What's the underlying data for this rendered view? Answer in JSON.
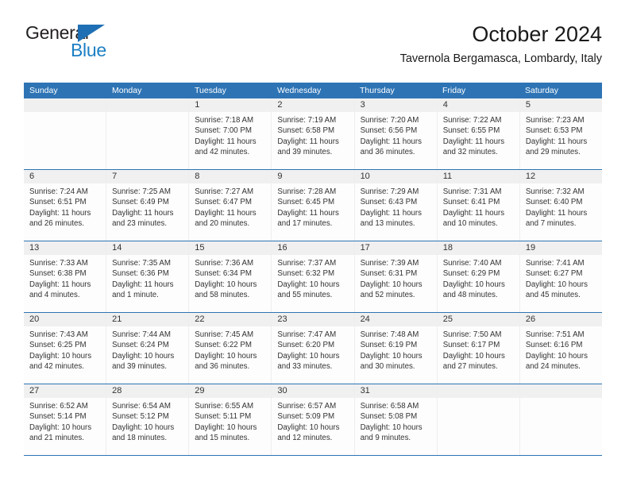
{
  "brand": {
    "name_top": "General",
    "name_bottom": "Blue",
    "colors": {
      "dark": "#231f20",
      "blue": "#1c7fc4",
      "triangle": "#1f6fb4"
    }
  },
  "header": {
    "title": "October 2024",
    "subtitle": "Tavernola Bergamasca, Lombardy, Italy"
  },
  "theme": {
    "header_blue": "#2e74b5",
    "date_band": "#f0f0f0",
    "cell_bg": "#fdfdfd",
    "column_line": "#eeeeee"
  },
  "weekdays": [
    "Sunday",
    "Monday",
    "Tuesday",
    "Wednesday",
    "Thursday",
    "Friday",
    "Saturday"
  ],
  "weeks": [
    [
      {
        "day": "",
        "sunrise": "",
        "sunset": "",
        "daylight": ""
      },
      {
        "day": "",
        "sunrise": "",
        "sunset": "",
        "daylight": ""
      },
      {
        "day": "1",
        "sunrise": "Sunrise: 7:18 AM",
        "sunset": "Sunset: 7:00 PM",
        "daylight": "Daylight: 11 hours and 42 minutes."
      },
      {
        "day": "2",
        "sunrise": "Sunrise: 7:19 AM",
        "sunset": "Sunset: 6:58 PM",
        "daylight": "Daylight: 11 hours and 39 minutes."
      },
      {
        "day": "3",
        "sunrise": "Sunrise: 7:20 AM",
        "sunset": "Sunset: 6:56 PM",
        "daylight": "Daylight: 11 hours and 36 minutes."
      },
      {
        "day": "4",
        "sunrise": "Sunrise: 7:22 AM",
        "sunset": "Sunset: 6:55 PM",
        "daylight": "Daylight: 11 hours and 32 minutes."
      },
      {
        "day": "5",
        "sunrise": "Sunrise: 7:23 AM",
        "sunset": "Sunset: 6:53 PM",
        "daylight": "Daylight: 11 hours and 29 minutes."
      }
    ],
    [
      {
        "day": "6",
        "sunrise": "Sunrise: 7:24 AM",
        "sunset": "Sunset: 6:51 PM",
        "daylight": "Daylight: 11 hours and 26 minutes."
      },
      {
        "day": "7",
        "sunrise": "Sunrise: 7:25 AM",
        "sunset": "Sunset: 6:49 PM",
        "daylight": "Daylight: 11 hours and 23 minutes."
      },
      {
        "day": "8",
        "sunrise": "Sunrise: 7:27 AM",
        "sunset": "Sunset: 6:47 PM",
        "daylight": "Daylight: 11 hours and 20 minutes."
      },
      {
        "day": "9",
        "sunrise": "Sunrise: 7:28 AM",
        "sunset": "Sunset: 6:45 PM",
        "daylight": "Daylight: 11 hours and 17 minutes."
      },
      {
        "day": "10",
        "sunrise": "Sunrise: 7:29 AM",
        "sunset": "Sunset: 6:43 PM",
        "daylight": "Daylight: 11 hours and 13 minutes."
      },
      {
        "day": "11",
        "sunrise": "Sunrise: 7:31 AM",
        "sunset": "Sunset: 6:41 PM",
        "daylight": "Daylight: 11 hours and 10 minutes."
      },
      {
        "day": "12",
        "sunrise": "Sunrise: 7:32 AM",
        "sunset": "Sunset: 6:40 PM",
        "daylight": "Daylight: 11 hours and 7 minutes."
      }
    ],
    [
      {
        "day": "13",
        "sunrise": "Sunrise: 7:33 AM",
        "sunset": "Sunset: 6:38 PM",
        "daylight": "Daylight: 11 hours and 4 minutes."
      },
      {
        "day": "14",
        "sunrise": "Sunrise: 7:35 AM",
        "sunset": "Sunset: 6:36 PM",
        "daylight": "Daylight: 11 hours and 1 minute."
      },
      {
        "day": "15",
        "sunrise": "Sunrise: 7:36 AM",
        "sunset": "Sunset: 6:34 PM",
        "daylight": "Daylight: 10 hours and 58 minutes."
      },
      {
        "day": "16",
        "sunrise": "Sunrise: 7:37 AM",
        "sunset": "Sunset: 6:32 PM",
        "daylight": "Daylight: 10 hours and 55 minutes."
      },
      {
        "day": "17",
        "sunrise": "Sunrise: 7:39 AM",
        "sunset": "Sunset: 6:31 PM",
        "daylight": "Daylight: 10 hours and 52 minutes."
      },
      {
        "day": "18",
        "sunrise": "Sunrise: 7:40 AM",
        "sunset": "Sunset: 6:29 PM",
        "daylight": "Daylight: 10 hours and 48 minutes."
      },
      {
        "day": "19",
        "sunrise": "Sunrise: 7:41 AM",
        "sunset": "Sunset: 6:27 PM",
        "daylight": "Daylight: 10 hours and 45 minutes."
      }
    ],
    [
      {
        "day": "20",
        "sunrise": "Sunrise: 7:43 AM",
        "sunset": "Sunset: 6:25 PM",
        "daylight": "Daylight: 10 hours and 42 minutes."
      },
      {
        "day": "21",
        "sunrise": "Sunrise: 7:44 AM",
        "sunset": "Sunset: 6:24 PM",
        "daylight": "Daylight: 10 hours and 39 minutes."
      },
      {
        "day": "22",
        "sunrise": "Sunrise: 7:45 AM",
        "sunset": "Sunset: 6:22 PM",
        "daylight": "Daylight: 10 hours and 36 minutes."
      },
      {
        "day": "23",
        "sunrise": "Sunrise: 7:47 AM",
        "sunset": "Sunset: 6:20 PM",
        "daylight": "Daylight: 10 hours and 33 minutes."
      },
      {
        "day": "24",
        "sunrise": "Sunrise: 7:48 AM",
        "sunset": "Sunset: 6:19 PM",
        "daylight": "Daylight: 10 hours and 30 minutes."
      },
      {
        "day": "25",
        "sunrise": "Sunrise: 7:50 AM",
        "sunset": "Sunset: 6:17 PM",
        "daylight": "Daylight: 10 hours and 27 minutes."
      },
      {
        "day": "26",
        "sunrise": "Sunrise: 7:51 AM",
        "sunset": "Sunset: 6:16 PM",
        "daylight": "Daylight: 10 hours and 24 minutes."
      }
    ],
    [
      {
        "day": "27",
        "sunrise": "Sunrise: 6:52 AM",
        "sunset": "Sunset: 5:14 PM",
        "daylight": "Daylight: 10 hours and 21 minutes."
      },
      {
        "day": "28",
        "sunrise": "Sunrise: 6:54 AM",
        "sunset": "Sunset: 5:12 PM",
        "daylight": "Daylight: 10 hours and 18 minutes."
      },
      {
        "day": "29",
        "sunrise": "Sunrise: 6:55 AM",
        "sunset": "Sunset: 5:11 PM",
        "daylight": "Daylight: 10 hours and 15 minutes."
      },
      {
        "day": "30",
        "sunrise": "Sunrise: 6:57 AM",
        "sunset": "Sunset: 5:09 PM",
        "daylight": "Daylight: 10 hours and 12 minutes."
      },
      {
        "day": "31",
        "sunrise": "Sunrise: 6:58 AM",
        "sunset": "Sunset: 5:08 PM",
        "daylight": "Daylight: 10 hours and 9 minutes."
      },
      {
        "day": "",
        "sunrise": "",
        "sunset": "",
        "daylight": ""
      },
      {
        "day": "",
        "sunrise": "",
        "sunset": "",
        "daylight": ""
      }
    ]
  ]
}
